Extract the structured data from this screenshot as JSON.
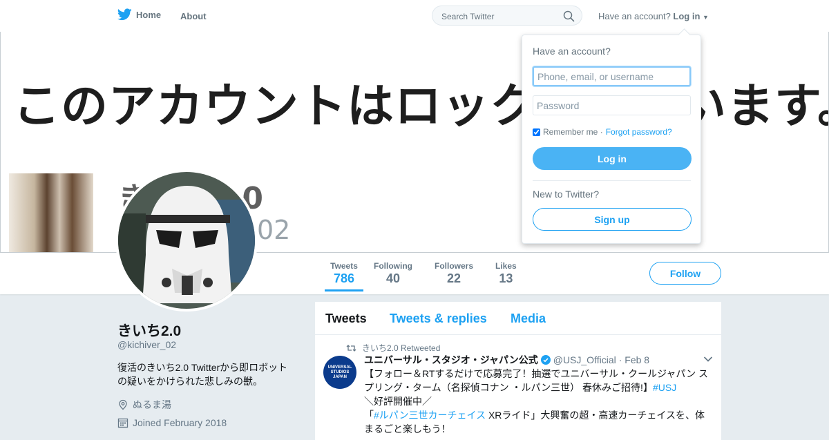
{
  "nav": {
    "home_label": "Home",
    "about_label": "About"
  },
  "search": {
    "placeholder": "Search Twitter"
  },
  "account": {
    "prompt": "Have an account?",
    "login_label": "Log in"
  },
  "banner": {
    "text": "このアカウントはロックされています。",
    "overlay_name": "きいち2.0",
    "overlay_handle": "_02"
  },
  "stats": [
    {
      "label": "Tweets",
      "value": "786"
    },
    {
      "label": "Following",
      "value": "40"
    },
    {
      "label": "Followers",
      "value": "22"
    },
    {
      "label": "Likes",
      "value": "13"
    }
  ],
  "follow_label": "Follow",
  "profile": {
    "name": "きいち2.0",
    "handle": "@kichiver_02",
    "bio": "復活のきいち2.0 Twitterから即ロボットの疑いをかけられた悲しみの獣。",
    "location": "ぬるま湯",
    "joined": "Joined February 2018"
  },
  "timeline": {
    "tabs": [
      "Tweets",
      "Tweets & replies",
      "Media"
    ],
    "tweet": {
      "retweet_line": "きいち2.0 Retweeted",
      "avatar_text": "UNIVERSAL STUDIOS JAPAN",
      "author_name": "ユニバーサル・スタジオ・ジャパン公式",
      "author_handle": "@USJ_Official",
      "date": "· Feb 8",
      "body_1": "【フォロー＆RTするだけで応募完了！抽選でユニバーサル・クールジャパン スプリング・ターム（名探偵コナン ・ルパン三世） 春休みご招待!】",
      "hashtag_1": "#USJ",
      "body_2": "＼好評開催中／",
      "quote_open": "「",
      "hashtag_2": "#ルパン三世カーチェイス",
      "body_3": " XRライド」大興奮の超・高速カーチェイスを、体まるごと楽しもう！"
    }
  },
  "login_dropdown": {
    "title": "Have an account?",
    "username_placeholder": "Phone, email, or username",
    "password_placeholder": "Password",
    "remember_label": "Remember me ·",
    "forgot_label": "Forgot password?",
    "login_button": "Log in",
    "new_prompt": "New to Twitter?",
    "signup_button": "Sign up"
  },
  "colors": {
    "accent": "#1da1f2",
    "login_button": "#4ab3f4",
    "page_bg": "#e6ecf0"
  }
}
